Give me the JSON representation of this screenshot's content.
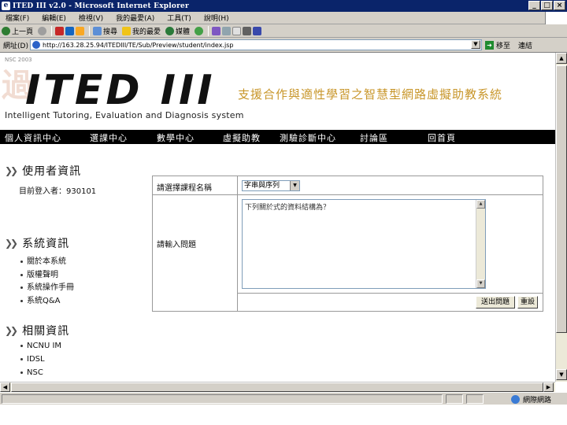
{
  "window": {
    "title": "ITED III v2.0 - Microsoft Internet Explorer",
    "buttons": [
      "_",
      "□",
      "×"
    ]
  },
  "menubar": [
    "檔案(F)",
    "編輯(E)",
    "檢視(V)",
    "我的最愛(A)",
    "工具(T)",
    "說明(H)"
  ],
  "toolbar": {
    "back": "上一頁",
    "search": "搜尋",
    "favorites": "我的最愛",
    "media": "媒體"
  },
  "address": {
    "label": "網址(D)",
    "url": "http://163.28.25.94/ITEDIII/TE/Sub/Preview/student/index.jsp",
    "go": "移至",
    "links": "連結"
  },
  "page": {
    "nsc_label": "NSC 2003",
    "logo_text": "ITED III",
    "logo_sub": "Intelligent Tutoring, Evaluation and Diagnosis system",
    "site_title": "支援合作與適性學習之智慧型網路虛擬助教系統",
    "nav": [
      "個人資訊中心",
      "選課中心",
      "數學中心",
      "虛擬助教",
      "測驗診斷中心",
      "討論區",
      "回首頁"
    ]
  },
  "sidebar": {
    "user_heading": "使用者資訊",
    "user_text": "目前登入者：930101",
    "system_heading": "系統資訊",
    "system_links": [
      "關於本系統",
      "版權聲明",
      "系統操作手冊",
      "系統Q&A"
    ],
    "related_heading": "相關資訊",
    "related_links": [
      "NCNU IM",
      "IDSL",
      "NSC"
    ]
  },
  "form": {
    "course_label": "請選擇課程名稱",
    "course_value": "字串與序列",
    "question_label": "請輸入問題",
    "question_value": "下列關於式的資料結構為？",
    "submit_label": "送出問題",
    "reset_label": "重設"
  },
  "status": {
    "zone": "網際網路"
  }
}
